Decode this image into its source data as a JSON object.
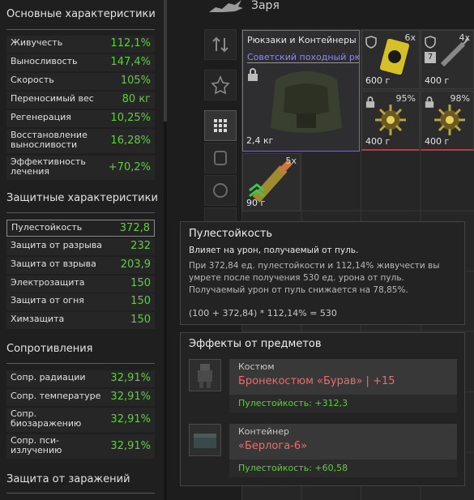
{
  "stats": {
    "sections": [
      "Основные характеристики",
      "Защитные характеристики",
      "Сопротивления",
      "Защита от заражений"
    ],
    "main": [
      {
        "label": "Живучесть",
        "value": "112,1%"
      },
      {
        "label": "Выносливость",
        "value": "147,4%"
      },
      {
        "label": "Скорость",
        "value": "105%"
      },
      {
        "label": "Переносимый вес",
        "value": "80 кг"
      },
      {
        "label": "Регенерация",
        "value": "10,25%"
      },
      {
        "label": "Восстановление выносливости",
        "value": "16,28%"
      },
      {
        "label": "Эффективность лечения",
        "value": "+70,2%"
      }
    ],
    "defense": [
      {
        "label": "Пулестойкость",
        "value": "372,8"
      },
      {
        "label": "Защита от разрыва",
        "value": "232"
      },
      {
        "label": "Защита от взрыва",
        "value": "203,9"
      },
      {
        "label": "Электрозащита",
        "value": "150"
      },
      {
        "label": "Защита от огня",
        "value": "150"
      },
      {
        "label": "Химзащита",
        "value": "150"
      }
    ],
    "resist": [
      {
        "label": "Сопр. радиации",
        "value": "32,91%"
      },
      {
        "label": "Сопр. температуре",
        "value": "32,91%"
      },
      {
        "label": "Сопр. биозаражению",
        "value": "32,91%"
      },
      {
        "label": "Сопр. пси-излучению",
        "value": "32,91%"
      }
    ]
  },
  "inventory": {
    "title": "Заря",
    "backpack": {
      "category": "Рюкзаки и Контейнеры",
      "name": "Советский походный рю...",
      "weight": "2,4 кг"
    },
    "items": [
      {
        "count": "6x",
        "weight": "600 г"
      },
      {
        "count": "4x",
        "weight": "400 г"
      },
      {
        "count": "95%",
        "weight": "400 г"
      },
      {
        "count": "98%",
        "weight": "400 г"
      },
      {
        "count": "5x",
        "weight": "90 г"
      }
    ],
    "syringe_tier": "7"
  },
  "tooltip": {
    "title": "Пулестойкость",
    "subtitle": "Влияет на урон, получаемый от пуль.",
    "para": "При 372,84 ед. пулестойкости и 112,14% живучести вы умрете после получения 530 ед. урона от пуль. Получаемый урон от пуль снижается на 78,85%.",
    "formula": "(100 + 372,84) * 112,14% = 530"
  },
  "effects": {
    "title": "Эффекты от предметов",
    "cards": [
      {
        "category": "Костюм",
        "name": "Бронекостюм «Бурав» | +15",
        "bonus": "Пулестойкость: +312,3"
      },
      {
        "category": "Контейнер",
        "name": "«Берлога-6»",
        "bonus": "Пулестойкость: +60,58"
      }
    ]
  },
  "colors": {
    "positive": "#5ecf3c",
    "item_name": "#f06a6a",
    "link": "#8a8cf0"
  }
}
